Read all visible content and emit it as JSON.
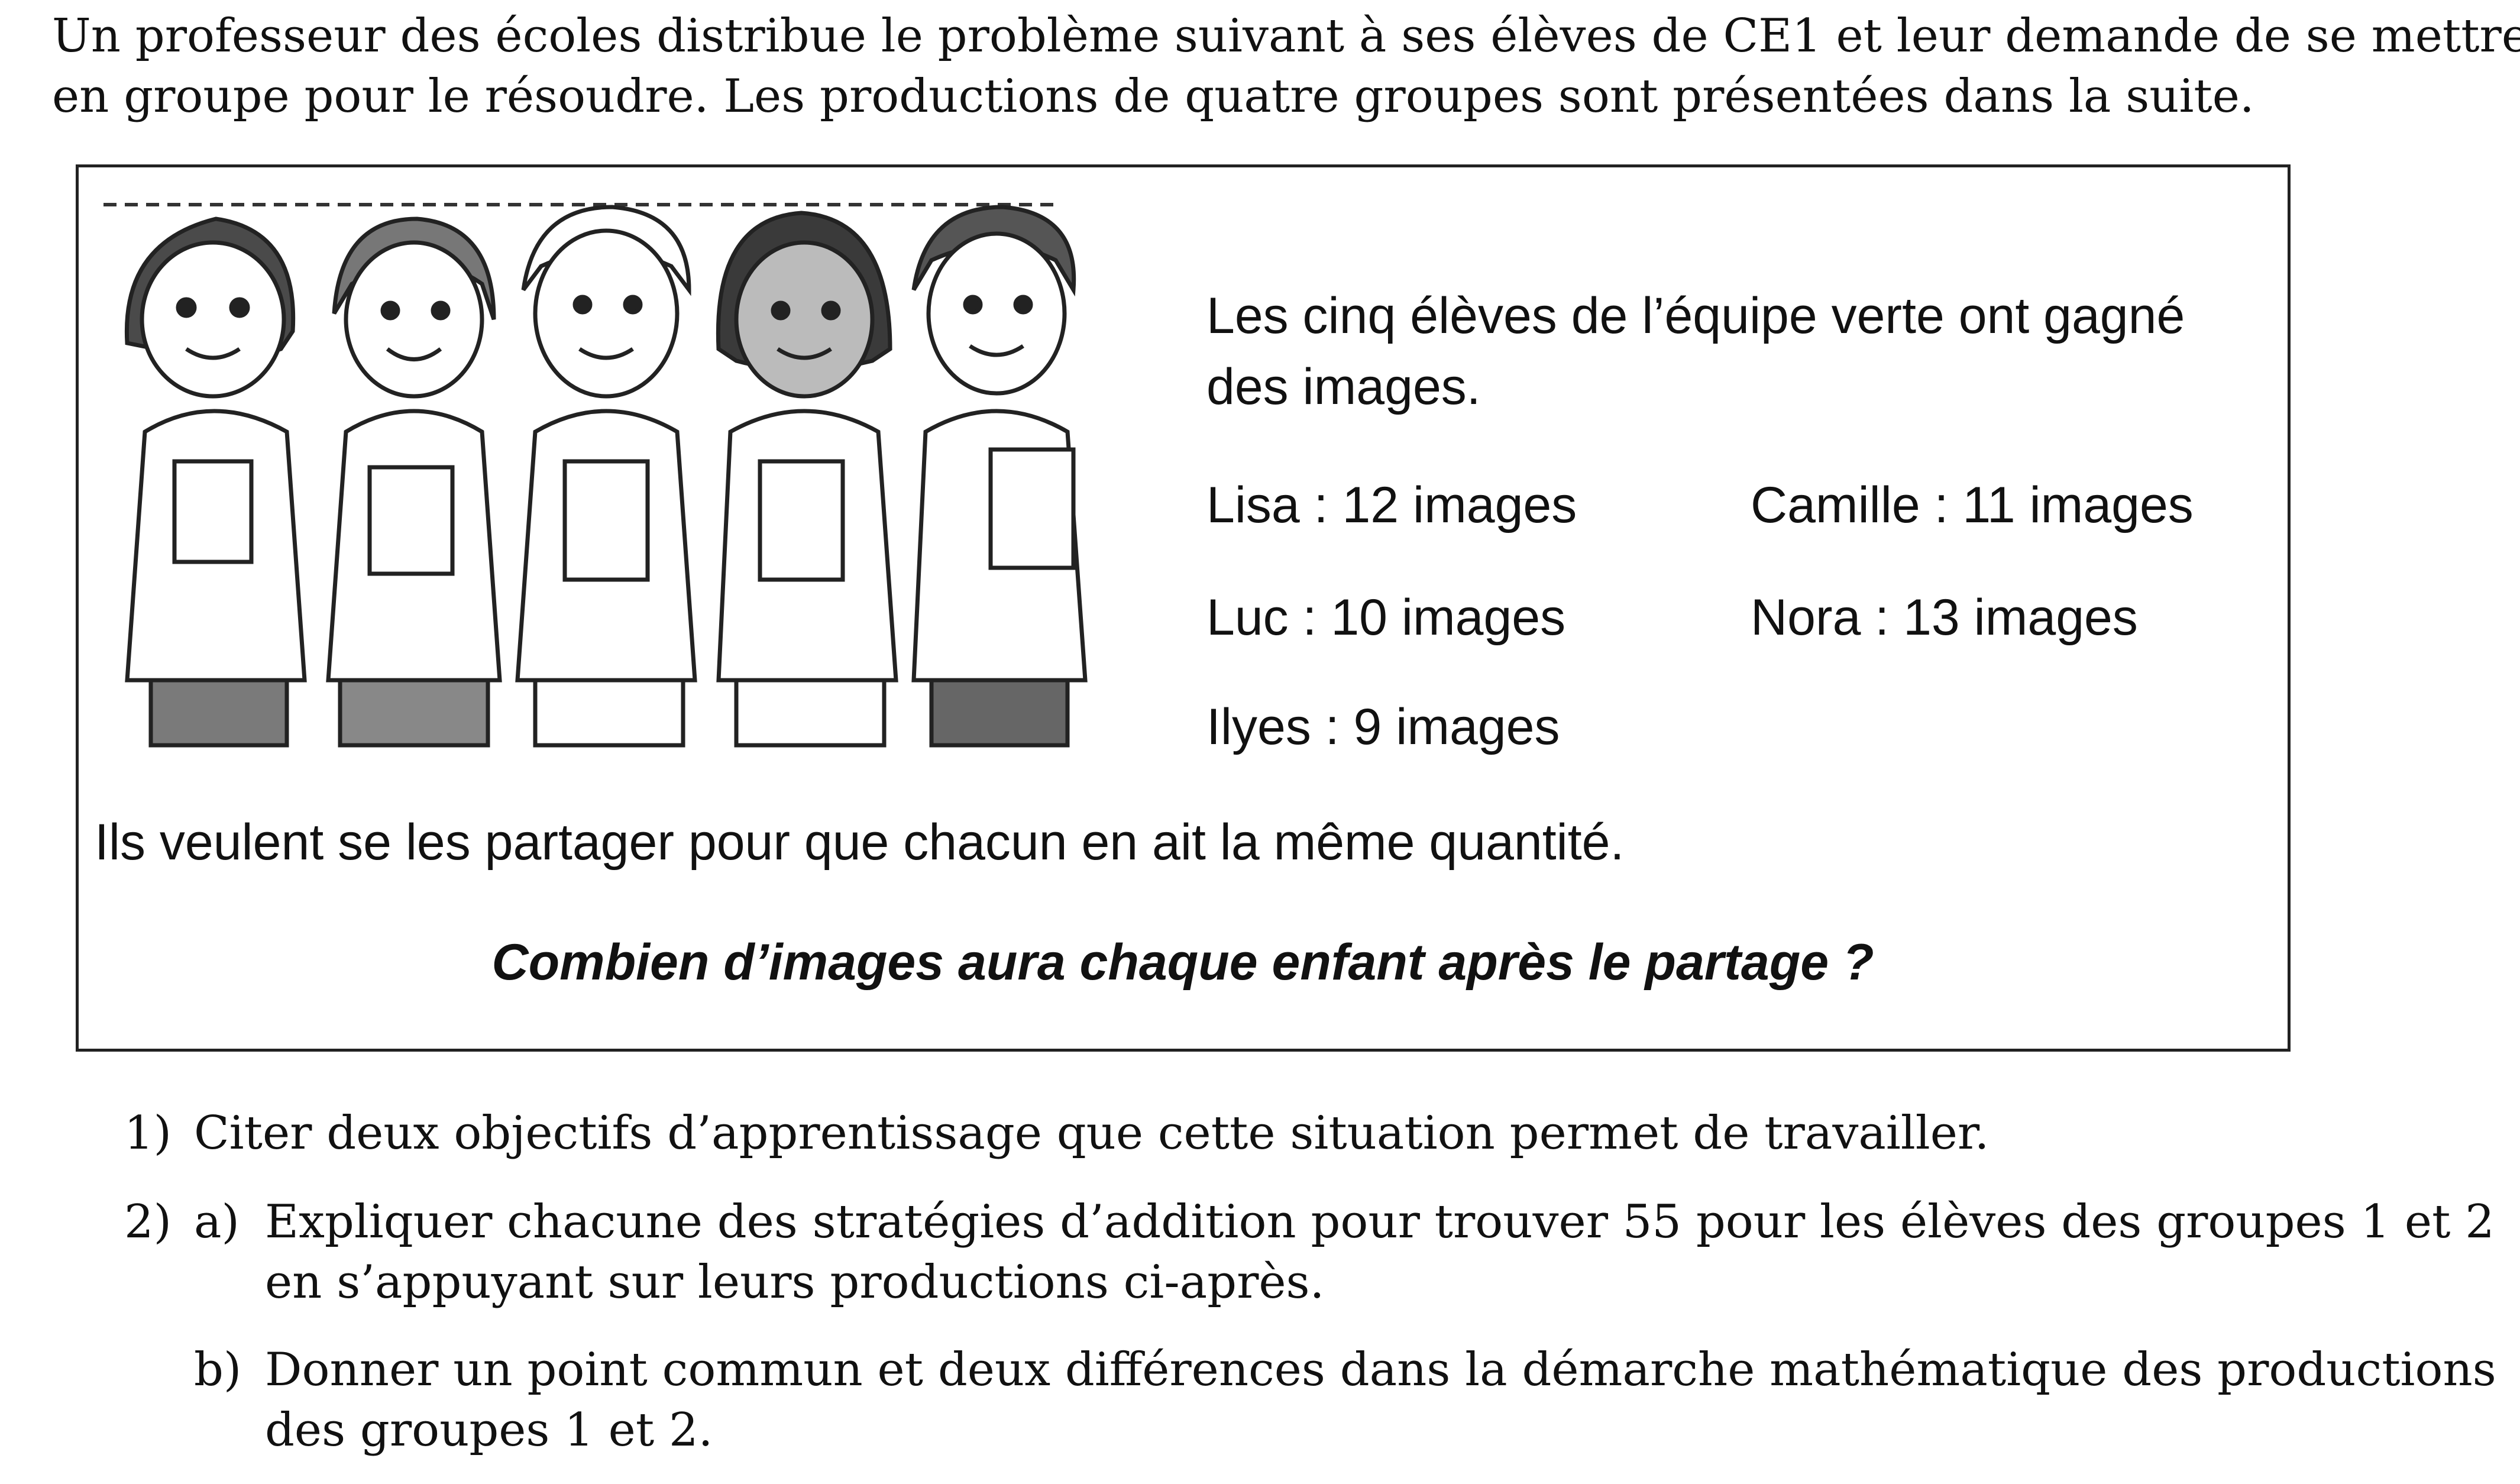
{
  "intro": {
    "line1": "Un professeur des écoles distribue le problème suivant à ses élèves de CE1 et leur demande de se mettre",
    "line2": "en groupe pour le résoudre. Les productions de quatre groupes sont présentées dans la suite."
  },
  "problem": {
    "statement_line1": "Les cinq élèves de l’équipe verte ont gagné",
    "statement_line2": "des images.",
    "children": [
      {
        "text": "Lisa : 12 images"
      },
      {
        "text": "Camille : 11 images"
      },
      {
        "text": "Luc : 10 images"
      },
      {
        "text": "Nora : 13 images"
      },
      {
        "text": "Ilyes : 9 images"
      }
    ],
    "share_sentence": "Ils veulent se les partager pour que chacun en ait la même quantité.",
    "question": "Combien d’images aura chaque enfant après le partage ?"
  },
  "questions": {
    "q1_num": "1)",
    "q1_text": "Citer deux objectifs d’apprentissage que cette situation permet de travailler.",
    "q2_num": "2)",
    "q2a_letter": "a)",
    "q2a_line1": "Expliquer chacune des stratégies d’addition pour trouver 55 pour les élèves des groupes 1 et 2",
    "q2a_line2": "en s’appuyant sur leurs productions ci-après.",
    "q2b_letter": "b)",
    "q2b_line1": "Donner un point commun et deux différences dans la démarche mathématique des productions",
    "q2b_line2": "des groupes 1 et 2."
  }
}
